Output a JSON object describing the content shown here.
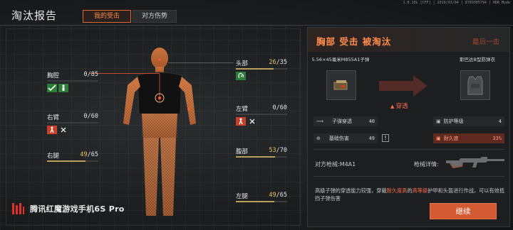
{
  "status_bar": "1.0.10L [CFF]  |  2019/03/04  |  8789305794  |  HDR Mode",
  "header": {
    "title": "淘汰报告",
    "tabs": [
      {
        "label": "我的受击",
        "active": true
      },
      {
        "label": "对方伤势",
        "active": false
      }
    ]
  },
  "body_parts": {
    "chest": {
      "name": "胸腔",
      "current": "0",
      "max": "/85",
      "fraction": 0
    },
    "head": {
      "name": "头部",
      "current": "26",
      "max": "/35",
      "fraction": 0.743
    },
    "right_arm": {
      "name": "右臂",
      "current": "0",
      "max": "/60",
      "fraction": 0
    },
    "left_arm": {
      "name": "左臂",
      "current": "0",
      "max": "/60",
      "fraction": 0
    },
    "right_leg": {
      "name": "右腿",
      "current": "49",
      "max": "/65",
      "fraction": 0.754
    },
    "abdomen": {
      "name": "腹部",
      "current": "53",
      "max": "/70",
      "fraction": 0.757
    },
    "left_leg": {
      "name": "左腿",
      "current": "49",
      "max": "/65",
      "fraction": 0.754
    }
  },
  "logo": {
    "text": "腾讯红魔游戏手机6S Pro"
  },
  "report": {
    "title": "胸部  受击  被淘汰",
    "final_hit": "最后一击",
    "ammo_name": "5.56×45毫米M855A1子弹",
    "armor_name": "斯巴达B型防弹衣",
    "penetrate": "穿透",
    "ammo_stats": [
      {
        "label": "子弹穿透",
        "value": "40"
      },
      {
        "label": "基础伤害",
        "value": "49"
      }
    ],
    "armor_stats": [
      {
        "label": "防护等级",
        "value": "4"
      },
      {
        "label": "耐久度",
        "value": "33%"
      }
    ],
    "warning": "!",
    "enemy_weapon": "对方枪械:M4A1",
    "weapon_detail": "枪械详情:",
    "desc_parts": [
      "高级子弹的穿透能力较强，穿戴",
      "耐久度高",
      "的",
      "高等级",
      "护甲和头盔进行作战，可以有效抵挡子弹伤害"
    ],
    "continue_label": "继续"
  },
  "colors": {
    "accent": "#ff8c4a",
    "button": "#d35a32",
    "bar_fill": "#b8a05a",
    "danger": "#c8402a",
    "ok": "#2f7d3a"
  }
}
